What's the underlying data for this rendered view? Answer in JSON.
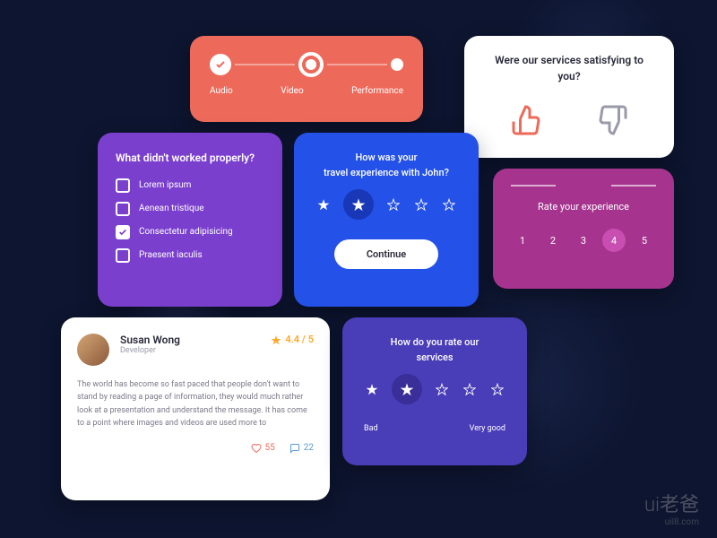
{
  "progress": {
    "steps": [
      "Audio",
      "Video",
      "Performance"
    ]
  },
  "satisfy": {
    "title": "Were our services satisfying to you?"
  },
  "checklist": {
    "title": "What didn't worked properly?",
    "items": [
      {
        "label": "Lorem ipsum",
        "checked": false
      },
      {
        "label": "Aenean tristique",
        "checked": false
      },
      {
        "label": "Consectetur adipisicing",
        "checked": true
      },
      {
        "label": "Praesent iaculis",
        "checked": false
      }
    ]
  },
  "travel": {
    "title_line1": "How was your",
    "title_line2": "travel experience with John?",
    "continue": "Continue",
    "rating": 2
  },
  "rate": {
    "title": "Rate your experience",
    "max": 5,
    "selected": 4,
    "nums": [
      "1",
      "2",
      "3",
      "4",
      "5"
    ]
  },
  "review": {
    "name": "Susan Wong",
    "role": "Developer",
    "score": "4.4 / 5",
    "text": "The world has become so fast paced that people don't want to stand by reading a page of information, they would much rather look at a presentation and understand the message. It has come to a point where images and videos are used more to",
    "likes": "55",
    "comments": "22"
  },
  "services": {
    "title_line1": "How do you rate our",
    "title_line2": "services",
    "label_bad": "Bad",
    "label_good": "Very good",
    "rating": 2
  },
  "watermark": {
    "logo": "ui老爸",
    "url": "uil8.com"
  }
}
